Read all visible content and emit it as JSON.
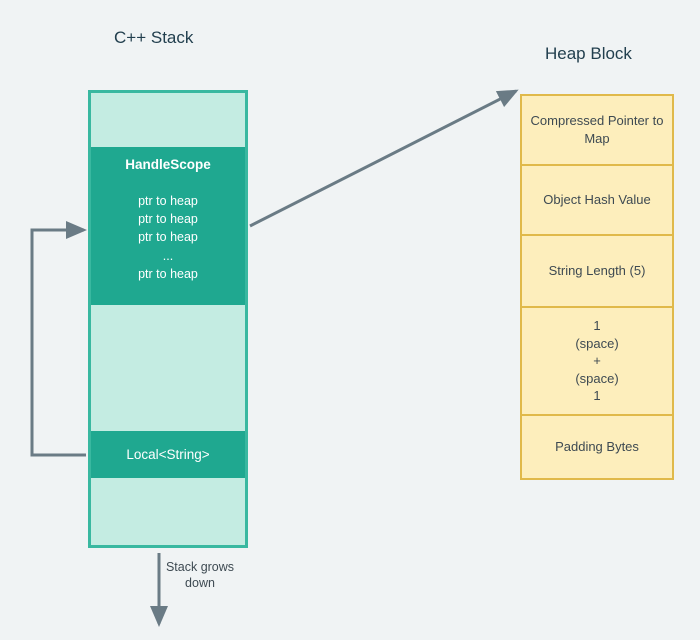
{
  "titles": {
    "stack": "C++ Stack",
    "heap": "Heap Block"
  },
  "stack": {
    "handlescope_title": "HandleScope",
    "ptrs": [
      "ptr to heap",
      "ptr to heap",
      "ptr to heap",
      "...",
      "ptr to heap"
    ],
    "local_label": "Local<String>"
  },
  "heap": {
    "cells": [
      "Compressed Pointer to Map",
      "Object Hash Value",
      "String Length (5)",
      "1\n(space)\n+\n(space)\n1",
      "Padding Bytes"
    ]
  },
  "arrow_label": "Stack grows down",
  "colors": {
    "teal_fill": "#1fa890",
    "teal_border": "#39b8a0",
    "pale_teal": "#c4ece2",
    "heap_fill": "#fdeebc",
    "heap_border": "#e0b94a",
    "arrow": "#6a7b85",
    "bg": "#f0f3f4",
    "title_text": "#223f4e"
  },
  "chart_data": {
    "type": "diagram",
    "description": "Memory layout diagram showing a C++ stack with a HandleScope containing heap pointers and a Local<String>, alongside a Heap Block broken into fields.",
    "stack_frames": [
      {
        "name": "spacer-top",
        "filled": false
      },
      {
        "name": "HandleScope",
        "filled": true,
        "contents": [
          "ptr to heap",
          "ptr to heap",
          "ptr to heap",
          "...",
          "ptr to heap"
        ]
      },
      {
        "name": "spacer-mid",
        "filled": false
      },
      {
        "name": "Local<String>",
        "filled": true
      },
      {
        "name": "spacer-bottom",
        "filled": false
      }
    ],
    "heap_fields": [
      "Compressed Pointer to Map",
      "Object Hash Value",
      "String Length (5)",
      "1 (space) + (space) 1",
      "Padding Bytes"
    ],
    "arrows": [
      {
        "from": "HandleScope ptr",
        "to": "Heap Block top",
        "kind": "straight"
      },
      {
        "from": "Local<String>",
        "to": "HandleScope",
        "kind": "loop-left"
      },
      {
        "from": "stack-bottom",
        "to": "down",
        "label": "Stack grows down"
      }
    ]
  }
}
